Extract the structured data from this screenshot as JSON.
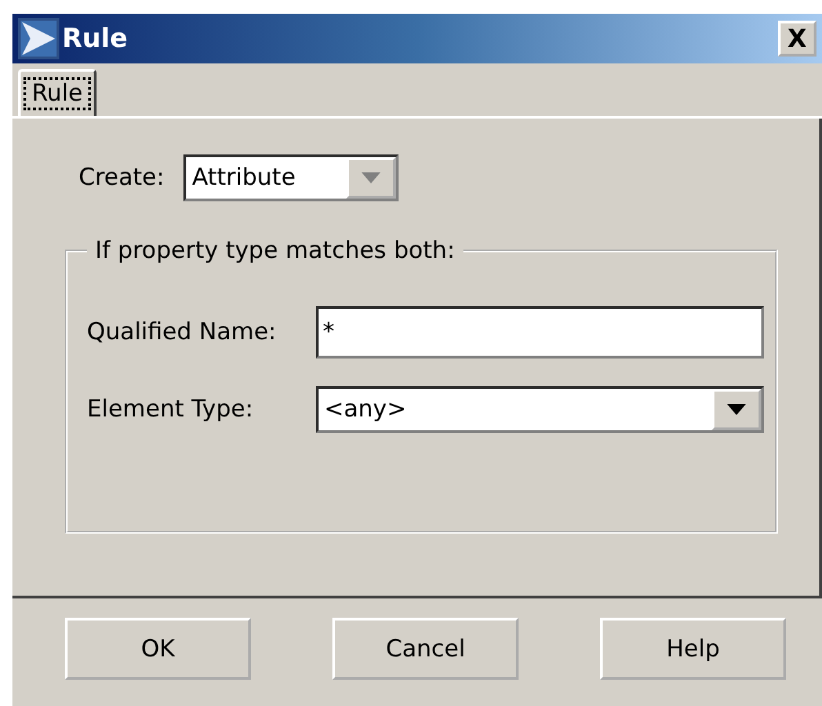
{
  "window": {
    "title": "Rule",
    "close": "X"
  },
  "tabs": [
    {
      "label": "Rule",
      "selected": true
    }
  ],
  "create": {
    "label": "Create:",
    "value": "Attribute"
  },
  "group": {
    "title": "If property type matches both:",
    "fields": [
      {
        "kind": "text",
        "label": "Qualified Name:",
        "value": "*"
      },
      {
        "kind": "combo",
        "label": "Element Type:",
        "value": "<any>"
      }
    ]
  },
  "buttons": [
    "OK",
    "Cancel",
    "Help"
  ]
}
